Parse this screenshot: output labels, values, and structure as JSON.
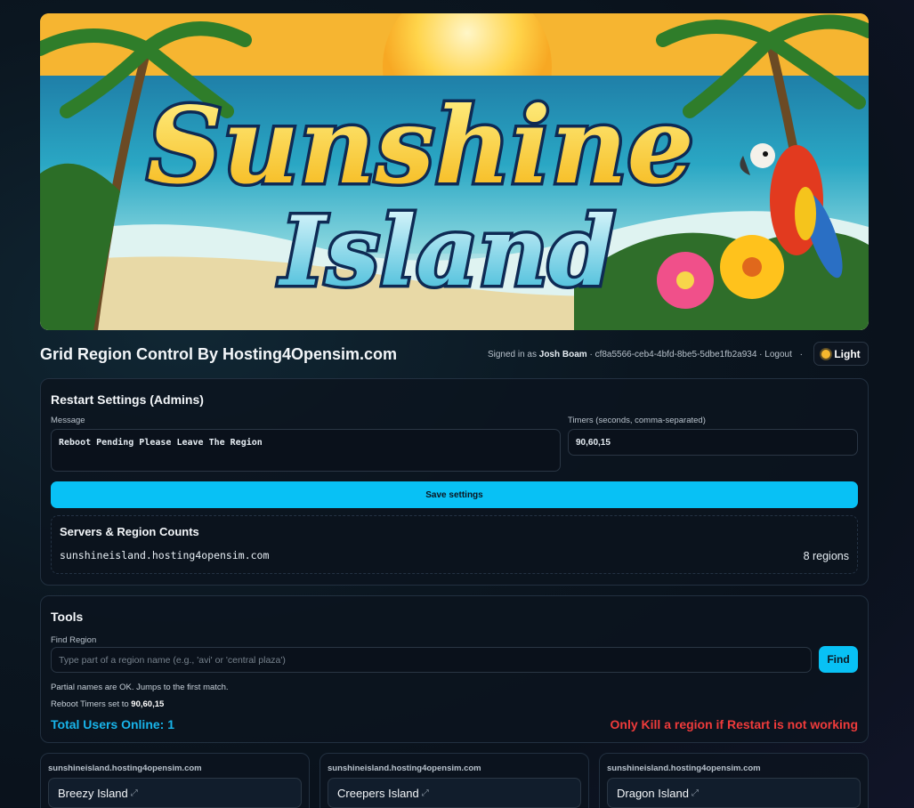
{
  "banner": {
    "title_line1": "Sunshine",
    "title_line2": "Island"
  },
  "header": {
    "app_title": "Grid Region Control By Hosting4Opensim.com",
    "signed_in_prefix": "Signed in as",
    "user_name": "Josh Boam",
    "user_id": "cf8a5566-ceb4-4bfd-8be5-5dbe1fb2a934",
    "logout_label": "Logout",
    "theme_toggle_label": "Light"
  },
  "restart_settings": {
    "title": "Restart Settings (Admins)",
    "message_label": "Message",
    "message_value": "Reboot Pending Please Leave The Region",
    "timers_label": "Timers (seconds, comma-separated)",
    "timers_value": "90,60,15",
    "save_label": "Save settings",
    "servers_title": "Servers & Region Counts",
    "servers": [
      {
        "host": "sunshineisland.hosting4opensim.com",
        "count": "8 regions"
      }
    ]
  },
  "tools": {
    "title": "Tools",
    "find_label": "Find Region",
    "find_placeholder": "Type part of a region name (e.g., 'avi' or 'central plaza')",
    "find_button": "Find",
    "hint": "Partial names are OK. Jumps to the first match.",
    "timers_prefix": "Reboot Timers set to",
    "timers_value": "90,60,15",
    "users_online": "Total Users Online: 1",
    "warning": "Only Kill a region if Restart is not working"
  },
  "regions": [
    {
      "host": "sunshineisland.hosting4opensim.com",
      "name": "Breezy Island"
    },
    {
      "host": "sunshineisland.hosting4opensim.com",
      "name": "Creepers Island"
    },
    {
      "host": "sunshineisland.hosting4opensim.com",
      "name": "Dragon Island"
    }
  ],
  "colors": {
    "accent": "#08c1f5",
    "warning": "#ef3b3b",
    "users": "#18b4ea"
  }
}
